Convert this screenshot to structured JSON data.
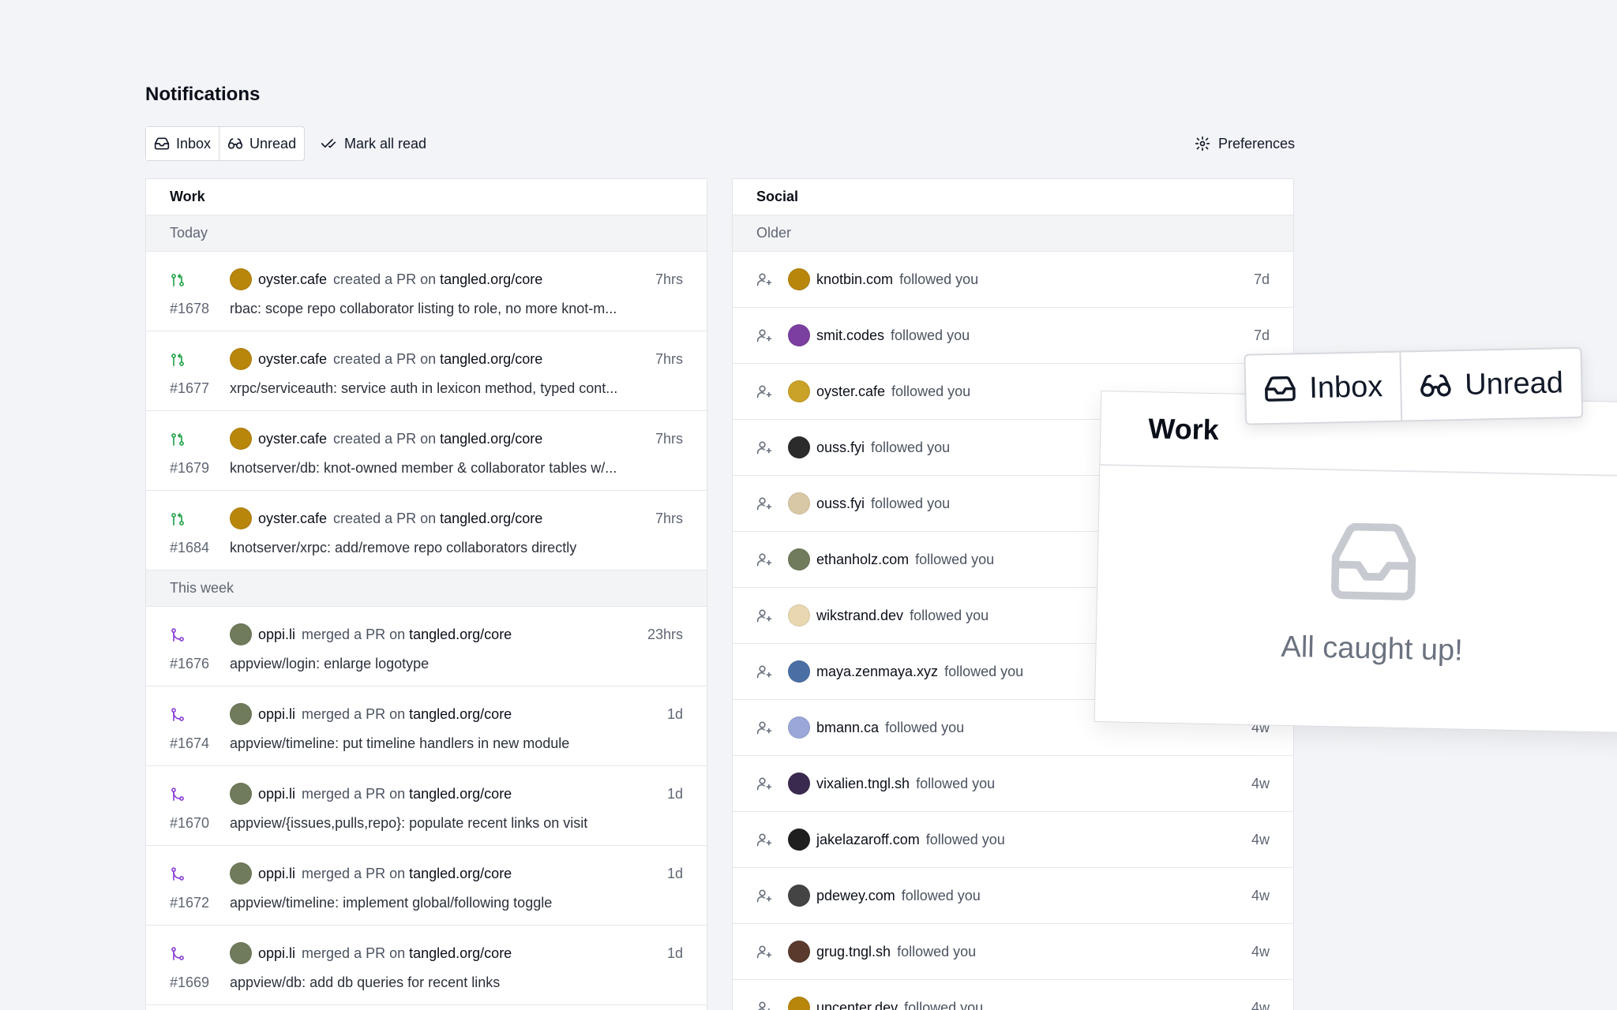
{
  "page": {
    "title": "Notifications"
  },
  "toolbar": {
    "inbox_label": "Inbox",
    "unread_label": "Unread",
    "mark_all_label": "Mark all read",
    "preferences_label": "Preferences"
  },
  "work": {
    "title": "Work",
    "groups": [
      {
        "label": "Today",
        "items": [
          {
            "icon": "pr-open-icon",
            "actor": "oyster.cafe",
            "verb": "created a PR on",
            "repo": "tangled.org/core",
            "time": "7hrs",
            "number": "#1678",
            "title": "rbac: scope repo collaborator listing to role, no more knot-m..."
          },
          {
            "icon": "pr-open-icon",
            "actor": "oyster.cafe",
            "verb": "created a PR on",
            "repo": "tangled.org/core",
            "time": "7hrs",
            "number": "#1677",
            "title": "xrpc/serviceauth: service auth in lexicon method, typed cont..."
          },
          {
            "icon": "pr-open-icon",
            "actor": "oyster.cafe",
            "verb": "created a PR on",
            "repo": "tangled.org/core",
            "time": "7hrs",
            "number": "#1679",
            "title": "knotserver/db: knot-owned member & collaborator tables w/..."
          },
          {
            "icon": "pr-open-icon",
            "actor": "oyster.cafe",
            "verb": "created a PR on",
            "repo": "tangled.org/core",
            "time": "7hrs",
            "number": "#1684",
            "title": "knotserver/xrpc: add/remove repo collaborators directly"
          }
        ]
      },
      {
        "label": "This week",
        "items": [
          {
            "icon": "pr-merged-icon",
            "actor": "oppi.li",
            "verb": "merged a PR on",
            "repo": "tangled.org/core",
            "time": "23hrs",
            "number": "#1676",
            "title": "appview/login: enlarge logotype"
          },
          {
            "icon": "pr-merged-icon",
            "actor": "oppi.li",
            "verb": "merged a PR on",
            "repo": "tangled.org/core",
            "time": "1d",
            "number": "#1674",
            "title": "appview/timeline: put timeline handlers in new module"
          },
          {
            "icon": "pr-merged-icon",
            "actor": "oppi.li",
            "verb": "merged a PR on",
            "repo": "tangled.org/core",
            "time": "1d",
            "number": "#1670",
            "title": "appview/{issues,pulls,repo}: populate recent links on visit"
          },
          {
            "icon": "pr-merged-icon",
            "actor": "oppi.li",
            "verb": "merged a PR on",
            "repo": "tangled.org/core",
            "time": "1d",
            "number": "#1672",
            "title": "appview/timeline: implement global/following toggle"
          },
          {
            "icon": "pr-merged-icon",
            "actor": "oppi.li",
            "verb": "merged a PR on",
            "repo": "tangled.org/core",
            "time": "1d",
            "number": "#1669",
            "title": "appview/db: add db queries for recent links"
          }
        ]
      }
    ]
  },
  "social": {
    "title": "Social",
    "group_label": "Older",
    "items": [
      {
        "actor": "knotbin.com",
        "verb": "followed you",
        "time": "7d"
      },
      {
        "actor": "smit.codes",
        "verb": "followed you",
        "time": "7d"
      },
      {
        "actor": "oyster.cafe",
        "verb": "followed you",
        "time": ""
      },
      {
        "actor": "ouss.fyi",
        "verb": "followed you",
        "time": ""
      },
      {
        "actor": "ouss.fyi",
        "verb": "followed you",
        "time": ""
      },
      {
        "actor": "ethanholz.com",
        "verb": "followed you",
        "time": ""
      },
      {
        "actor": "wikstrand.dev",
        "verb": "followed you",
        "time": ""
      },
      {
        "actor": "maya.zenmaya.xyz",
        "verb": "followed you",
        "time": ""
      },
      {
        "actor": "bmann.ca",
        "verb": "followed you",
        "time": "4w"
      },
      {
        "actor": "vixalien.tngl.sh",
        "verb": "followed you",
        "time": "4w"
      },
      {
        "actor": "jakelazaroff.com",
        "verb": "followed you",
        "time": "4w"
      },
      {
        "actor": "pdewey.com",
        "verb": "followed you",
        "time": "4w"
      },
      {
        "actor": "grug.tngl.sh",
        "verb": "followed you",
        "time": "4w"
      },
      {
        "actor": "uncenter.dev",
        "verb": "followed you",
        "time": "4w"
      }
    ]
  },
  "overlay": {
    "inbox_label": "Inbox",
    "unread_label": "Unread",
    "title": "Work",
    "empty_message": "All caught up!"
  },
  "colors": {
    "pr_open": "#22a34a",
    "pr_merged": "#8b3fd6",
    "avatar_palette": [
      "#b8860b",
      "#7a3fa0",
      "#c9a227",
      "#2b2b2b",
      "#d9c8a5",
      "#6f7b5a",
      "#e8d7b0",
      "#4a6fa5",
      "#9aa7d8",
      "#3b2a4f",
      "#1f1f1f",
      "#444",
      "#5b3a2e"
    ]
  }
}
